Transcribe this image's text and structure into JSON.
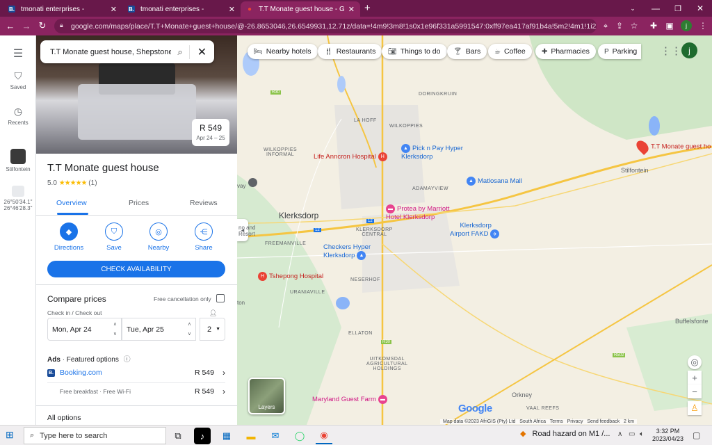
{
  "browser": {
    "tabs": [
      {
        "title": "tmonati enterprises -",
        "favicon": "booking-icon",
        "active": false
      },
      {
        "title": "tmonati enterprises -",
        "favicon": "booking-icon",
        "active": false
      },
      {
        "title": "T.T Monate guest house - Googl",
        "favicon": "maps-pin-icon",
        "active": true
      }
    ],
    "new_tab": "+",
    "url": "google.com/maps/place/T.T+Monate+guest+house/@-26.8653046,26.6549931,12.71z/data=!4m9!3m8!1s0x1e96f331a5991547:0xff97ea417af91b4a!5m2!4m1!1i2!8m2!3...",
    "profile_initial": "j",
    "accent": "#8b2460"
  },
  "rail": {
    "saved": "Saved",
    "recents": "Recents",
    "recent_place": "Stilfontein",
    "coords_line1": "26°50'34.1\"",
    "coords_line2": "26°46'28.3\""
  },
  "panel": {
    "search_query": "T.T Monate guest house, Shepstone R",
    "price_badge": {
      "price": "R 549",
      "dates": "Apr 24 – 25"
    },
    "title": "T.T Monate guest house",
    "rating": "5.0",
    "stars": "★★★★★",
    "review_count": "(1)",
    "tabs": [
      "Overview",
      "Prices",
      "Reviews"
    ],
    "actions": [
      "Directions",
      "Save",
      "Nearby",
      "Share"
    ],
    "check_availability": "CHECK AVAILABILITY",
    "compare_prices": "Compare prices",
    "free_cancellation": "Free cancellation only",
    "checkin_checkout": "Check in / Check out",
    "checkin": "Mon, Apr 24",
    "checkout": "Tue, Apr 25",
    "guests": "2",
    "ads_label": "Ads",
    "featured": "Featured options",
    "offers": [
      {
        "name": "Booking.com",
        "price": "R 549"
      },
      {
        "name": "Free breakfast · Free Wi-Fi",
        "price": "R 549"
      }
    ],
    "all_options": "All options"
  },
  "map": {
    "chips": [
      "Nearby hotels",
      "Restaurants",
      "Things to do",
      "Bars",
      "Coffee",
      "Pharmacies",
      "Parking"
    ],
    "avatar_initial": "j",
    "layers": "Layers",
    "labels": {
      "doringkruin": "DORINGKRUIN",
      "la_hoff": "LA HOFF",
      "wilkoppies": "WILKOPPIES",
      "wilkoppies_informal": "WILKOPPIES\nINFORMAL",
      "adamayview": "ADAMAYVIEW",
      "klerksdorp": "Klerksdorp",
      "klerksdorp_central": "KLERKSDORP\nCENTRAL",
      "freemanville": "FREEMANVILLE",
      "uraniaville": "URANIAVILLE",
      "neserhof": "NESERHOF",
      "ellaton": "ELLATON",
      "uitkomsdal": "UITKOMSDAL\nAGRICULTURAL\nHOLDINGS",
      "stilfontein": "Stilfontein",
      "buffelsfontein": "Buffelsfonte",
      "orkney": "Orkney",
      "vaal_reefs": "VAAL REEFS",
      "resort": "no and\nResort",
      "vay": "vay",
      "ton": "ton"
    },
    "pois": {
      "anncron": "Life Anncron Hospital",
      "pnp": "Pick n Pay Hyper\nKlerksdorp",
      "matlosana": "Matlosana Mall",
      "protea": "Protea by Marriott\nHotel Klerksdorp",
      "airport": "Klerksdorp\nAirport FAKD",
      "checkers": "Checkers Hyper\nKlerksdorp",
      "tshepong": "Tshepong Hospital",
      "maryland": "Maryland Guest Farm",
      "tt_monate": "T.T Monate guest ho"
    },
    "roads": {
      "r30a": "R30",
      "r30b": "R30",
      "r502": "R502",
      "r12": "12",
      "r12b": "12"
    },
    "google": "Google",
    "attribution": [
      "Map data ©2023 AfriGIS (Pty) Ltd",
      "South Africa",
      "Terms",
      "Privacy",
      "Send feedback",
      "2 km"
    ]
  },
  "taskbar": {
    "search_placeholder": "Type here to search",
    "news": "Road hazard on M1 /...",
    "time": "3:32 PM",
    "date": "2023/04/23"
  }
}
